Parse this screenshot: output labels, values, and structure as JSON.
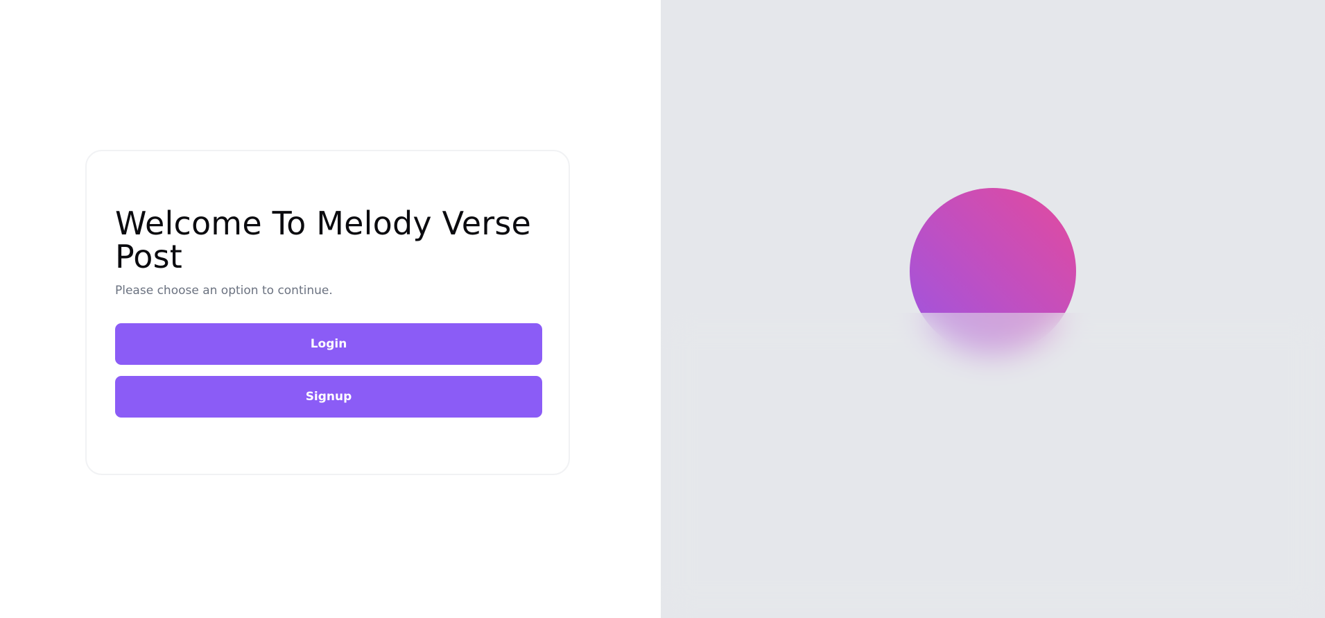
{
  "welcome": {
    "title": "Welcome To Melody Verse Post",
    "subtitle": "Please choose an option to continue.",
    "login_label": "Login",
    "signup_label": "Signup"
  },
  "colors": {
    "accent": "#8b5cf6",
    "panel_background": "#e5e7eb",
    "orb_gradient_start": "#9b55e2",
    "orb_gradient_end": "#e34a9d"
  }
}
